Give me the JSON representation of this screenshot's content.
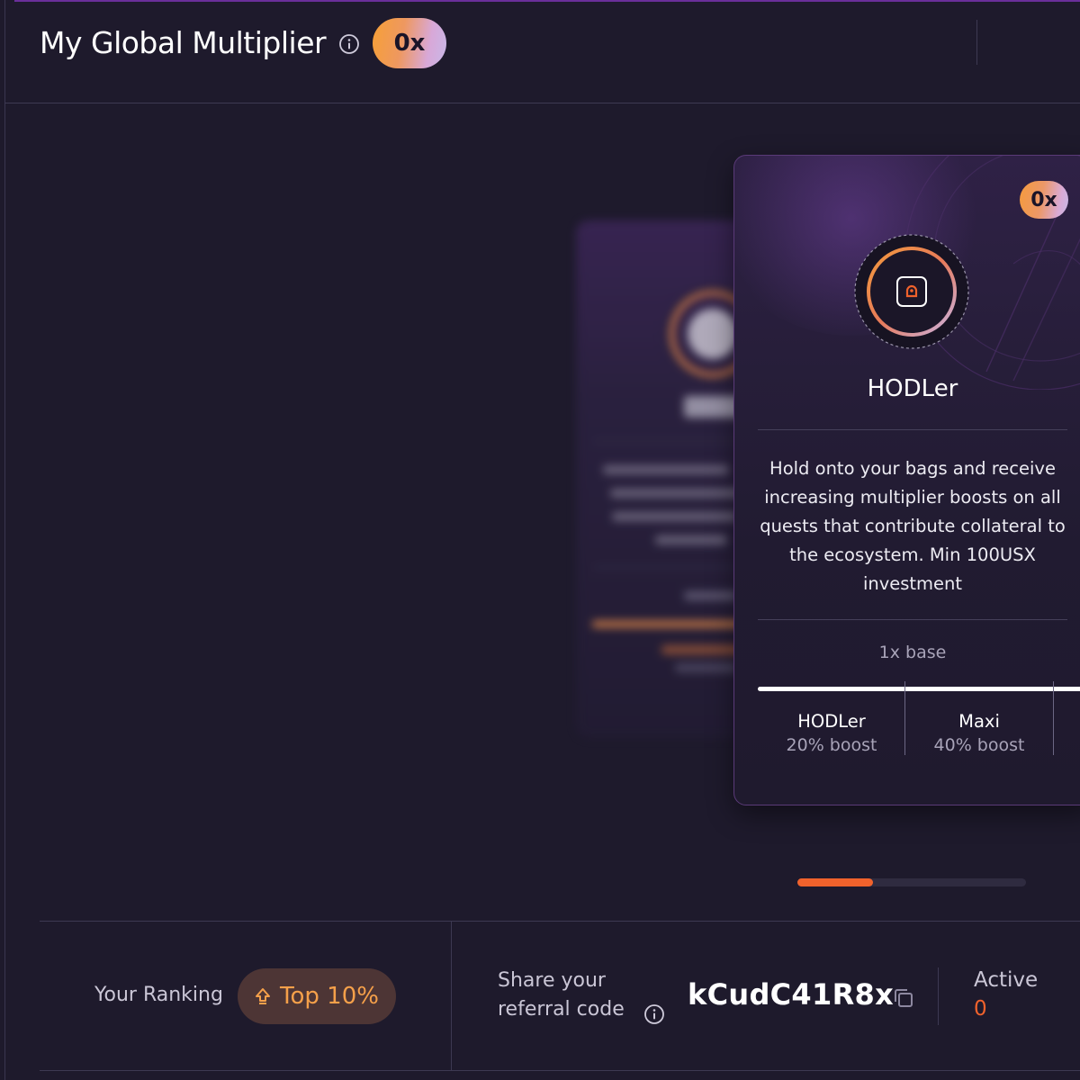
{
  "header": {
    "title": "My Global Multiplier",
    "multiplier": "0x"
  },
  "card": {
    "multiplier": "0x",
    "badge_icon": "lock-icon",
    "title": "HODLer",
    "description": "Hold onto your bags and receive increasing multiplier boosts on all quests that contribute collateral to the ecosystem. Min 100USX investment",
    "base_label": "1x base",
    "tiers": [
      {
        "name": "HODLer",
        "boost": "20% boost"
      },
      {
        "name": "Maxi",
        "boost": "40% boost"
      }
    ]
  },
  "carousel": {
    "progress": 0.33
  },
  "footer": {
    "ranking_label": "Your Ranking",
    "ranking_value": "Top 10%",
    "share_label": "Share your referral code",
    "referral_code": "kCudC41R8x",
    "active_label": "Active",
    "active_value": "0"
  },
  "colors": {
    "background": "#1e1a2c",
    "accent_orange": "#f0622c",
    "ranking_orange": "#f5a04a",
    "pill_gradient_start": "#f7a036",
    "pill_gradient_end": "#c8b8e8"
  }
}
